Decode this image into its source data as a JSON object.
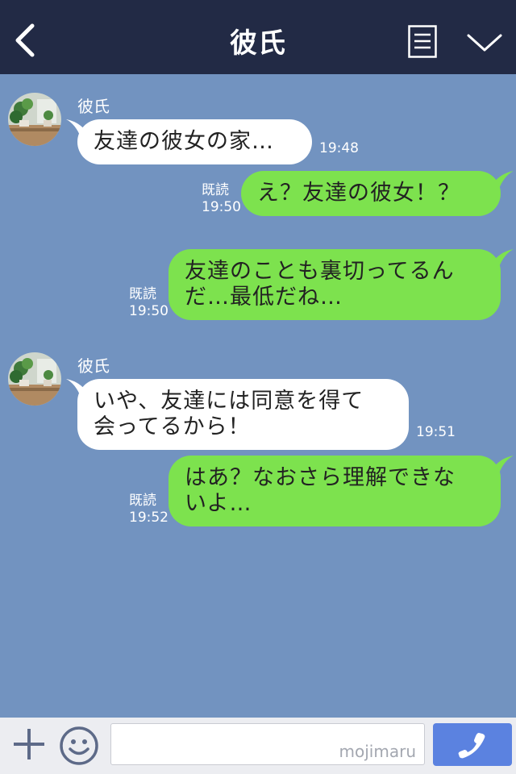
{
  "header": {
    "title": "彼氏"
  },
  "messages": [
    {
      "direction": "in",
      "sender": "彼氏",
      "text": "友達の彼女の家…",
      "time": "19:48"
    },
    {
      "direction": "out",
      "text": "え？友達の彼女！？",
      "read": "既読",
      "time": "19:50"
    },
    {
      "direction": "out",
      "text": "友達のことも裏切ってるん\nだ…最低だね…",
      "read": "既読",
      "time": "19:50"
    },
    {
      "direction": "in",
      "sender": "彼氏",
      "text": "いや、友達には同意を得て\n会ってるから！",
      "time": "19:51"
    },
    {
      "direction": "out",
      "text": "はあ？なおさら理解できな\nいよ…",
      "read": "既読",
      "time": "19:52"
    }
  ],
  "footer": {
    "input_value": "",
    "watermark": "mojimaru"
  },
  "colors": {
    "header_bg": "#222a45",
    "chat_bg": "#7293c0",
    "incoming_bubble": "#ffffff",
    "outgoing_bubble": "#7de24e",
    "call_button": "#5b82e0"
  },
  "icons": {
    "back": "chevron-left-icon",
    "menu": "notes-icon",
    "dropdown": "chevron-down-icon",
    "plus": "plus-icon",
    "emoji": "smiley-icon",
    "call": "phone-icon",
    "avatar": "plant-avatar"
  }
}
